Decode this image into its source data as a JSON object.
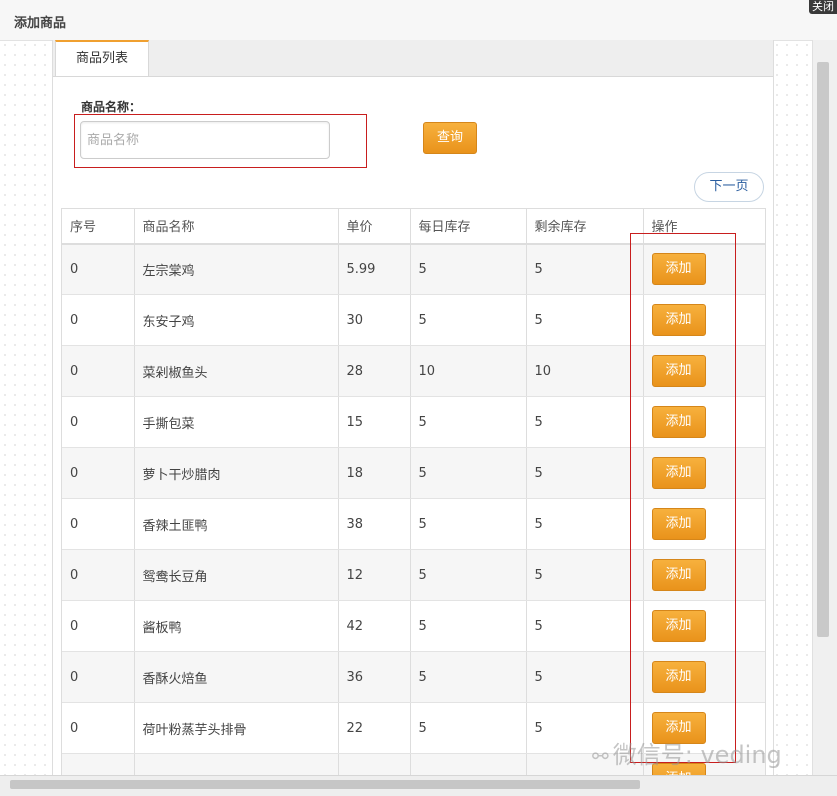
{
  "dialog": {
    "title": "添加商品",
    "close_label": "关闭"
  },
  "tabs": [
    {
      "label": "商品列表",
      "active": true
    }
  ],
  "search": {
    "label": "商品名称：",
    "placeholder": "商品名称",
    "value": "",
    "query_button": "查询"
  },
  "pagination": {
    "next_label": "下一页"
  },
  "table": {
    "columns": [
      "序号",
      "商品名称",
      "单价",
      "每日库存",
      "剩余库存",
      "操作"
    ],
    "rows": [
      {
        "no": "0",
        "name": "左宗棠鸡",
        "price": "5.99",
        "daily": "5",
        "remain": "5",
        "action": "添加"
      },
      {
        "no": "0",
        "name": "东安子鸡",
        "price": "30",
        "daily": "5",
        "remain": "5",
        "action": "添加"
      },
      {
        "no": "0",
        "name": "菜剁椒鱼头",
        "price": "28",
        "daily": "10",
        "remain": "10",
        "action": "添加"
      },
      {
        "no": "0",
        "name": "手撕包菜",
        "price": "15",
        "daily": "5",
        "remain": "5",
        "action": "添加"
      },
      {
        "no": "0",
        "name": "萝卜干炒腊肉",
        "price": "18",
        "daily": "5",
        "remain": "5",
        "action": "添加"
      },
      {
        "no": "0",
        "name": "香辣土匪鸭",
        "price": "38",
        "daily": "5",
        "remain": "5",
        "action": "添加"
      },
      {
        "no": "0",
        "name": "鸳鸯长豆角",
        "price": "12",
        "daily": "5",
        "remain": "5",
        "action": "添加"
      },
      {
        "no": "0",
        "name": "酱板鸭",
        "price": "42",
        "daily": "5",
        "remain": "5",
        "action": "添加"
      },
      {
        "no": "0",
        "name": "香酥火焙鱼",
        "price": "36",
        "daily": "5",
        "remain": "5",
        "action": "添加"
      },
      {
        "no": "0",
        "name": "荷叶粉蒸芋头排骨",
        "price": "22",
        "daily": "5",
        "remain": "5",
        "action": "添加"
      },
      {
        "no": "",
        "name": "",
        "price": "",
        "daily": "",
        "remain": "",
        "action": "添加"
      }
    ]
  },
  "watermark": {
    "icon": "wechat-icon",
    "text": "微信号: veding"
  },
  "colors": {
    "accent": "#f0a030",
    "annotation_red": "#c81e1e"
  }
}
